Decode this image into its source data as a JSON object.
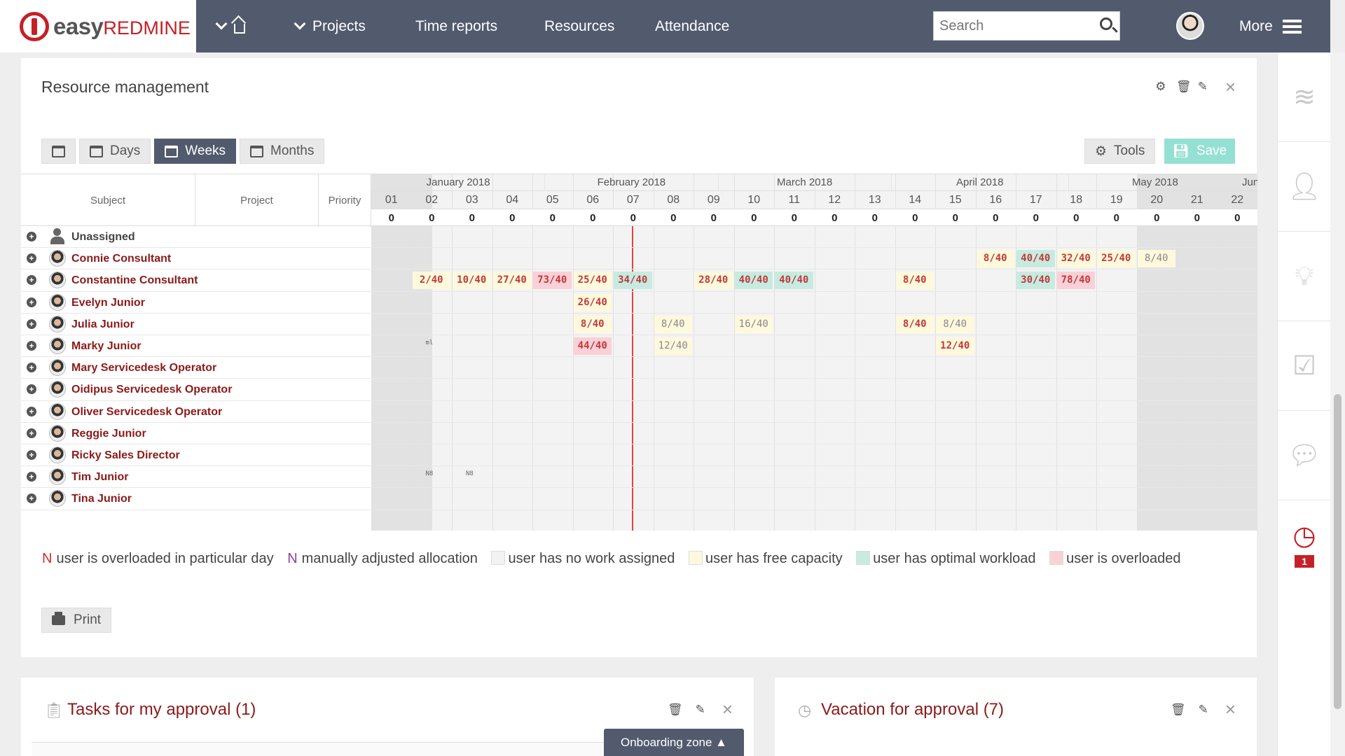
{
  "topbar": {
    "logo_main": "easy",
    "logo_accent": "REDMINE",
    "nav": [
      "Projects",
      "Time reports",
      "Resources",
      "Attendance"
    ],
    "search_placeholder": "Search",
    "more_label": "More"
  },
  "panel": {
    "title": "Resource management",
    "view_buttons": {
      "days": "Days",
      "weeks": "Weeks",
      "months": "Months"
    },
    "tools_label": "Tools",
    "save_label": "Save",
    "columns": {
      "subject": "Subject",
      "project": "Project",
      "priority": "Priority"
    },
    "months": [
      "January 2018",
      "February 2018",
      "March 2018",
      "April 2018",
      "May 2018",
      "Jun"
    ],
    "weeks": [
      "01",
      "02",
      "03",
      "04",
      "05",
      "06",
      "07",
      "08",
      "09",
      "10",
      "11",
      "12",
      "13",
      "14",
      "15",
      "16",
      "17",
      "18",
      "19",
      "20",
      "21",
      "22"
    ],
    "week_totals": [
      "0",
      "0",
      "0",
      "0",
      "0",
      "0",
      "0",
      "0",
      "0",
      "0",
      "0",
      "0",
      "0",
      "0",
      "0",
      "0",
      "0",
      "0",
      "0",
      "0",
      "0",
      "0"
    ],
    "users": [
      {
        "name": "Unassigned"
      },
      {
        "name": "Connie Consultant"
      },
      {
        "name": "Constantine Consultant"
      },
      {
        "name": "Evelyn Junior"
      },
      {
        "name": "Julia Junior"
      },
      {
        "name": "Marky Junior"
      },
      {
        "name": "Mary Servicedesk Operator"
      },
      {
        "name": "Oidipus Servicedesk Operator"
      },
      {
        "name": "Oliver Servicedesk Operator"
      },
      {
        "name": "Reggie Junior"
      },
      {
        "name": "Ricky Sales Director"
      },
      {
        "name": "Tim Junior"
      },
      {
        "name": "Tina Junior"
      }
    ],
    "allocations": [
      {
        "row": 1,
        "week": 15,
        "text": "8/40",
        "state": "free"
      },
      {
        "row": 1,
        "week": 16,
        "text": "40/40",
        "state": "opt"
      },
      {
        "row": 1,
        "week": 17,
        "text": "32/40",
        "state": "free"
      },
      {
        "row": 1,
        "week": 18,
        "text": "25/40",
        "state": "free"
      },
      {
        "row": 1,
        "week": 19,
        "text": "8/40",
        "state": "free",
        "manual": true
      },
      {
        "row": 2,
        "week": 1,
        "text": "2/40",
        "state": "free"
      },
      {
        "row": 2,
        "week": 2,
        "text": "10/40",
        "state": "free"
      },
      {
        "row": 2,
        "week": 3,
        "text": "27/40",
        "state": "free"
      },
      {
        "row": 2,
        "week": 4,
        "text": "73/40",
        "state": "over"
      },
      {
        "row": 2,
        "week": 5,
        "text": "25/40",
        "state": "free"
      },
      {
        "row": 2,
        "week": 6,
        "text": "34/40",
        "state": "opt"
      },
      {
        "row": 2,
        "week": 8,
        "text": "28/40",
        "state": "free"
      },
      {
        "row": 2,
        "week": 9,
        "text": "40/40",
        "state": "opt"
      },
      {
        "row": 2,
        "week": 10,
        "text": "40/40",
        "state": "opt"
      },
      {
        "row": 2,
        "week": 13,
        "text": "8/40",
        "state": "free"
      },
      {
        "row": 2,
        "week": 16,
        "text": "30/40",
        "state": "opt"
      },
      {
        "row": 2,
        "week": 17,
        "text": "78/40",
        "state": "over"
      },
      {
        "row": 3,
        "week": 5,
        "text": "26/40",
        "state": "free"
      },
      {
        "row": 4,
        "week": 5,
        "text": "8/40",
        "state": "free"
      },
      {
        "row": 4,
        "week": 7,
        "text": "8/40",
        "state": "free",
        "manual": true
      },
      {
        "row": 4,
        "week": 9,
        "text": "16/40",
        "state": "free",
        "manual": true
      },
      {
        "row": 4,
        "week": 13,
        "text": "8/40",
        "state": "free"
      },
      {
        "row": 4,
        "week": 14,
        "text": "8/40",
        "state": "free",
        "manual": true
      },
      {
        "row": 5,
        "week": 5,
        "text": "44/40",
        "state": "over"
      },
      {
        "row": 5,
        "week": 7,
        "text": "12/40",
        "state": "free",
        "manual": true
      },
      {
        "row": 5,
        "week": 14,
        "text": "12/40",
        "state": "free"
      }
    ],
    "minis": [
      {
        "row": 5,
        "week": 1,
        "text": "ml"
      },
      {
        "row": 11,
        "week": 1,
        "text": "N8"
      },
      {
        "row": 11,
        "week": 2,
        "text": "N8"
      }
    ],
    "legend": {
      "overloaded_day_mark": "N",
      "overloaded_day": "user is overloaded in particular day",
      "manual_mark": "N",
      "manual": "manually adjusted allocation",
      "no_work": "user has no work assigned",
      "free_capacity": "user has free capacity",
      "optimal": "user has optimal workload",
      "overloaded": "user is overloaded"
    },
    "print_label": "Print"
  },
  "bottom": {
    "tasks_title": "Tasks for my approval (1)",
    "vacation_title": "Vacation for approval (7)",
    "onboarding": "Onboarding zone ▲"
  },
  "sidebar": {
    "badge": "1"
  },
  "colors": {
    "brand": "#c52027",
    "topbar": "#525a6e",
    "free": "#fef9dd",
    "optimal": "#c7ebe1",
    "overloaded": "#fbd0d7",
    "user_link": "#8b1a1a"
  }
}
